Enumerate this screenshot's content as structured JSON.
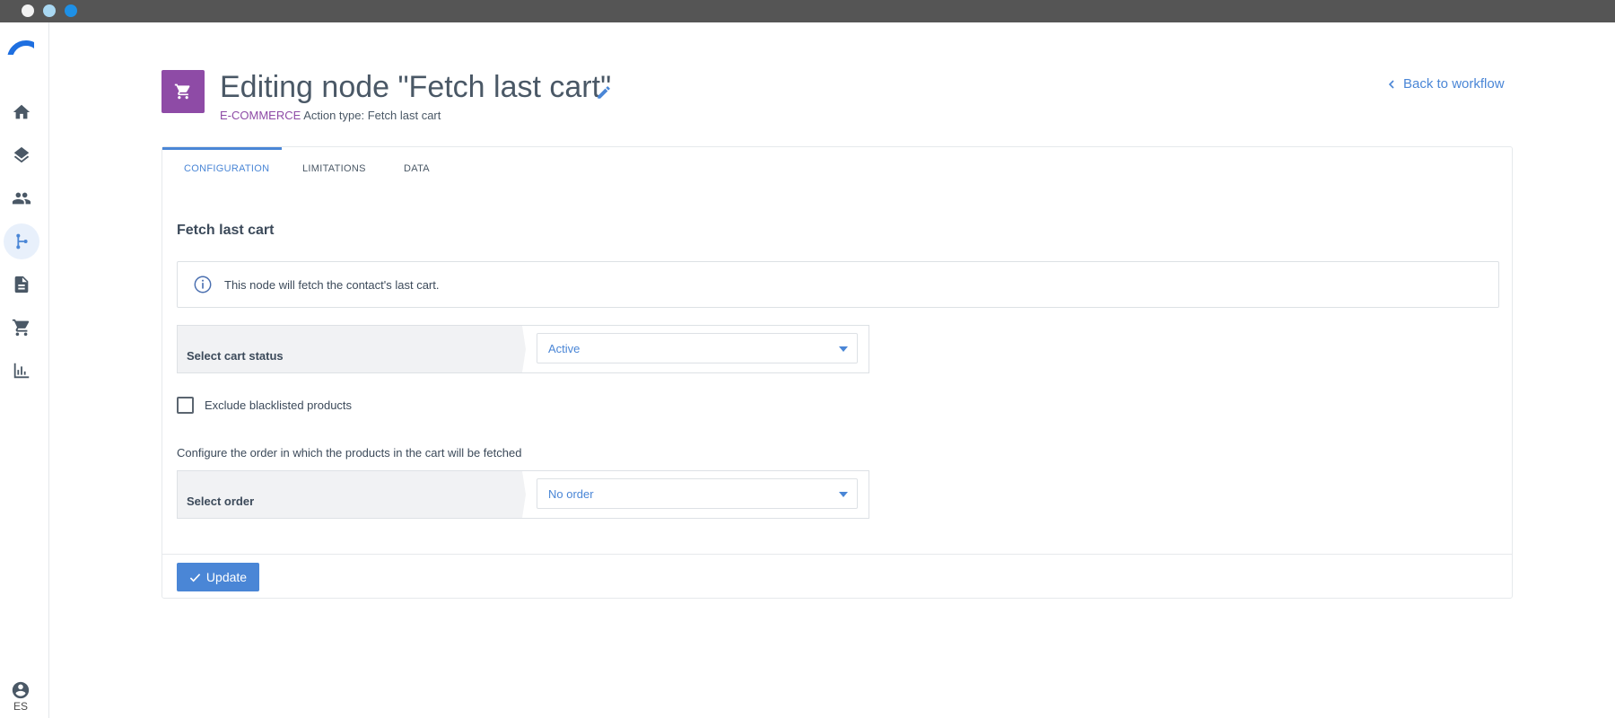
{
  "window": {
    "controls": [
      "close",
      "minimize",
      "maximize"
    ]
  },
  "sidebar": {
    "logo": "brand-logo",
    "items": [
      {
        "icon": "home-icon",
        "active": false
      },
      {
        "icon": "layers-icon",
        "active": false
      },
      {
        "icon": "contacts-icon",
        "active": false
      },
      {
        "icon": "workflow-icon",
        "active": true
      },
      {
        "icon": "document-icon",
        "active": false
      },
      {
        "icon": "cart-icon",
        "active": false
      },
      {
        "icon": "chart-icon",
        "active": false
      }
    ],
    "language": "ES"
  },
  "header": {
    "title": "Editing node \"Fetch last cart\"",
    "category": "E-COMMERCE",
    "action_type": "Action type: Fetch last cart",
    "back_link": "Back to workflow"
  },
  "tabs": [
    {
      "label": "CONFIGURATION",
      "active": true
    },
    {
      "label": "LIMITATIONS",
      "active": false
    },
    {
      "label": "DATA",
      "active": false
    }
  ],
  "form": {
    "section_title": "Fetch last cart",
    "info_text": "This node will fetch the contact's last cart.",
    "cart_status": {
      "label": "Select cart status",
      "value": "Active"
    },
    "exclude_blacklisted": {
      "label": "Exclude blacklisted products",
      "checked": false
    },
    "order_help": "Configure the order in which the products in the cart will be fetched",
    "order": {
      "label": "Select order",
      "value": "No order"
    },
    "update_label": "Update"
  },
  "colors": {
    "accent": "#4a86d6",
    "category": "#8e4ba6",
    "titlebar": "#555555"
  }
}
